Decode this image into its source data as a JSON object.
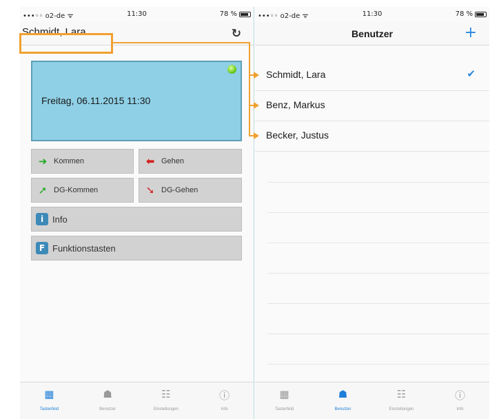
{
  "status_left": {
    "carrier": "•••◦◦ o2-de ᯤ",
    "time": "11:30",
    "battery": "78 %"
  },
  "status_right": {
    "carrier": "•••◦◦ o2-de ᯤ",
    "time": "11:30",
    "battery": "78 %"
  },
  "left": {
    "title": "Schmidt, Lara",
    "date_text": "Freitag, 06.11.2015 11:30",
    "buttons": [
      {
        "label": "Kommen",
        "icon": "arrow-right-green-icon"
      },
      {
        "label": "Gehen",
        "icon": "arrow-left-red-icon"
      },
      {
        "label": "DG-Kommen",
        "icon": "dg-kommen-icon"
      },
      {
        "label": "DG-Gehen",
        "icon": "dg-gehen-icon"
      },
      {
        "label": "Info",
        "icon": "info-icon"
      },
      {
        "label": "Funktionstasten",
        "icon": "function-keys-icon"
      }
    ],
    "tabs": [
      {
        "label": "Tastenfeld",
        "icon": "keypad-icon",
        "active": true
      },
      {
        "label": "Benutzer",
        "icon": "users-icon",
        "active": false
      },
      {
        "label": "Einstellungen",
        "icon": "settings-icon",
        "active": false
      },
      {
        "label": "Info",
        "icon": "info-circle-icon",
        "active": false
      }
    ]
  },
  "right": {
    "title": "Benutzer",
    "users": [
      {
        "name": "Schmidt, Lara",
        "selected": true
      },
      {
        "name": "Benz, Markus",
        "selected": false
      },
      {
        "name": "Becker, Justus",
        "selected": false
      }
    ],
    "tabs": [
      {
        "label": "Tastenfeld",
        "icon": "keypad-icon",
        "active": false
      },
      {
        "label": "Benutzer",
        "icon": "users-icon",
        "active": true
      },
      {
        "label": "Einstellungen",
        "icon": "settings-icon",
        "active": false
      },
      {
        "label": "Info",
        "icon": "info-circle-icon",
        "active": false
      }
    ]
  },
  "colors": {
    "accent": "#1f7fd8",
    "highlight": "#f0a030",
    "panel": "#8fd0e6",
    "status_ok": "#6ccc20"
  }
}
